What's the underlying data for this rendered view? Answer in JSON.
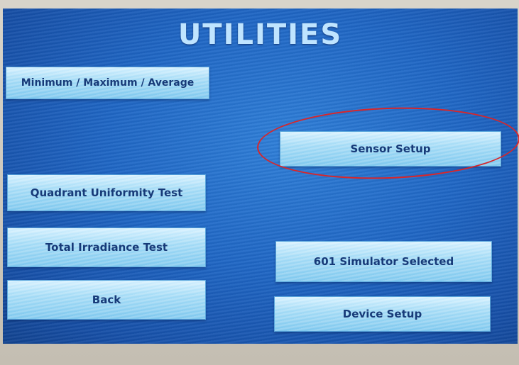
{
  "screen": {
    "title": "UTILITIES"
  },
  "buttons": {
    "min_max_avg": "Minimum / Maximum / Average",
    "sensor_setup": "Sensor Setup",
    "quadrant_uniformity": "Quadrant Uniformity Test",
    "total_irradiance": "Total Irradiance Test",
    "simulator_selected": "601 Simulator Selected",
    "back": "Back",
    "device_setup": "Device Setup"
  },
  "colors": {
    "screen_background": "#1f66c4",
    "button_face": "#a6dcf6",
    "button_text": "#173a78",
    "title_text": "#bfe4ff",
    "annotation_oval": "#d8262a"
  }
}
